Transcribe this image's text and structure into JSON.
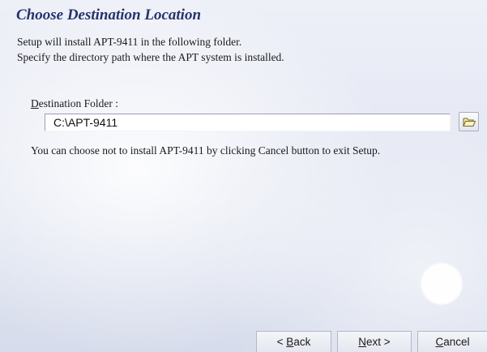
{
  "page": {
    "title": "Choose Destination Location",
    "intro_line_1": "Setup will install APT-9411 in the following folder.",
    "intro_line_2": "Specify the directory path where the APT system is installed."
  },
  "destination": {
    "label_mnemonic": "D",
    "label_rest": "estination Folder :",
    "value": "C:\\APT-9411",
    "browse_icon": "folder-icon"
  },
  "note": "You can choose not to install APT-9411 by clicking Cancel button to exit Setup.",
  "buttons": {
    "back_prefix": "< ",
    "back_mnemonic": "B",
    "back_rest": "ack",
    "next_mnemonic": "N",
    "next_rest": "ext >",
    "cancel_mnemonic": "C",
    "cancel_rest": "ancel"
  },
  "colors": {
    "title": "#24346b",
    "background": "#e6e9f4"
  }
}
